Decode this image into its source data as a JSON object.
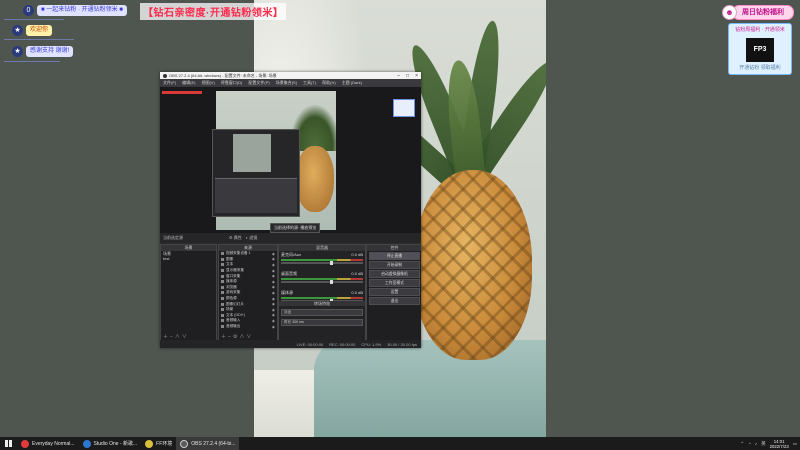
{
  "banner": {
    "text": "【钻石亲密度·开通钻粉领米】"
  },
  "chat": {
    "messages": [
      {
        "icon": "0",
        "text": "■ 一起来钻粉 · 开通钻粉领米 ■"
      },
      {
        "icon": "★",
        "text": "欢迎你"
      },
      {
        "icon": "★",
        "text": "感谢支持 谢谢!"
      }
    ]
  },
  "widget": {
    "title": "周日钻粉福利",
    "subtitle": "钻粉周福利 · 开通领米",
    "logo": "FP3",
    "caption": "开通钻粉 领取福利"
  },
  "obs": {
    "title": "OBS 27.2.4 (64-bit, windows) - 配置文件: 未命名 - 场景: 场景",
    "menu": [
      "文件(F)",
      "编辑(E)",
      "视图(V)",
      "停靠窗口(D)",
      "配置文件(P)",
      "场景集合(S)",
      "工具(T)",
      "帮助(H)",
      "主题 (Dark)"
    ],
    "tooltip": "当前选择的源: 播放预览",
    "bar": {
      "label": "当前选定源",
      "props": "属性",
      "filters": "滤镜"
    },
    "scenes": {
      "header": "场景",
      "items": [
        "场景",
        "test"
      ]
    },
    "sources": {
      "header": "来源",
      "items": [
        "视频采集设备 1",
        "图像",
        "文本",
        "显示器采集",
        "窗口采集",
        "媒体源",
        "浏览器",
        "游戏采集",
        "颜色源",
        "图像幻灯片",
        "场景",
        "文本 (GDI+)",
        "音频输入",
        "音频输出"
      ]
    },
    "mixer": {
      "header": "混音器",
      "channels": [
        {
          "name": "麦克风/Aux",
          "db": "0.0 dB"
        },
        {
          "name": "桌面音频",
          "db": "0.0 dB"
        },
        {
          "name": "媒体源",
          "db": "0.0 dB"
        }
      ],
      "transition": {
        "header": "转场特效",
        "value": "淡出",
        "duration_label": "时长",
        "duration": "300 ms"
      }
    },
    "controls": {
      "header": "控件",
      "buttons": [
        "停止直播",
        "开始录制",
        "启动虚拟摄像机",
        "工作室模式",
        "设置",
        "退出"
      ]
    },
    "status": [
      "LIVE: 00:00:00",
      "REC: 00:00:00",
      "CPU: 1.9%",
      "30.00 / 30.00 fps"
    ]
  },
  "taskbar": {
    "items": [
      {
        "label": "Everyday Normal...",
        "color": "#e03b3b"
      },
      {
        "label": "Studio One - 新歌...",
        "color": "#2d77d4"
      },
      {
        "label": "FF环境",
        "color": "#d9c23a"
      },
      {
        "label": "OBS 27.2.4 (64-bi...",
        "color": "#5a5a5a"
      }
    ],
    "time": "14:01",
    "date": "2022/7/23",
    "lang": "英"
  }
}
